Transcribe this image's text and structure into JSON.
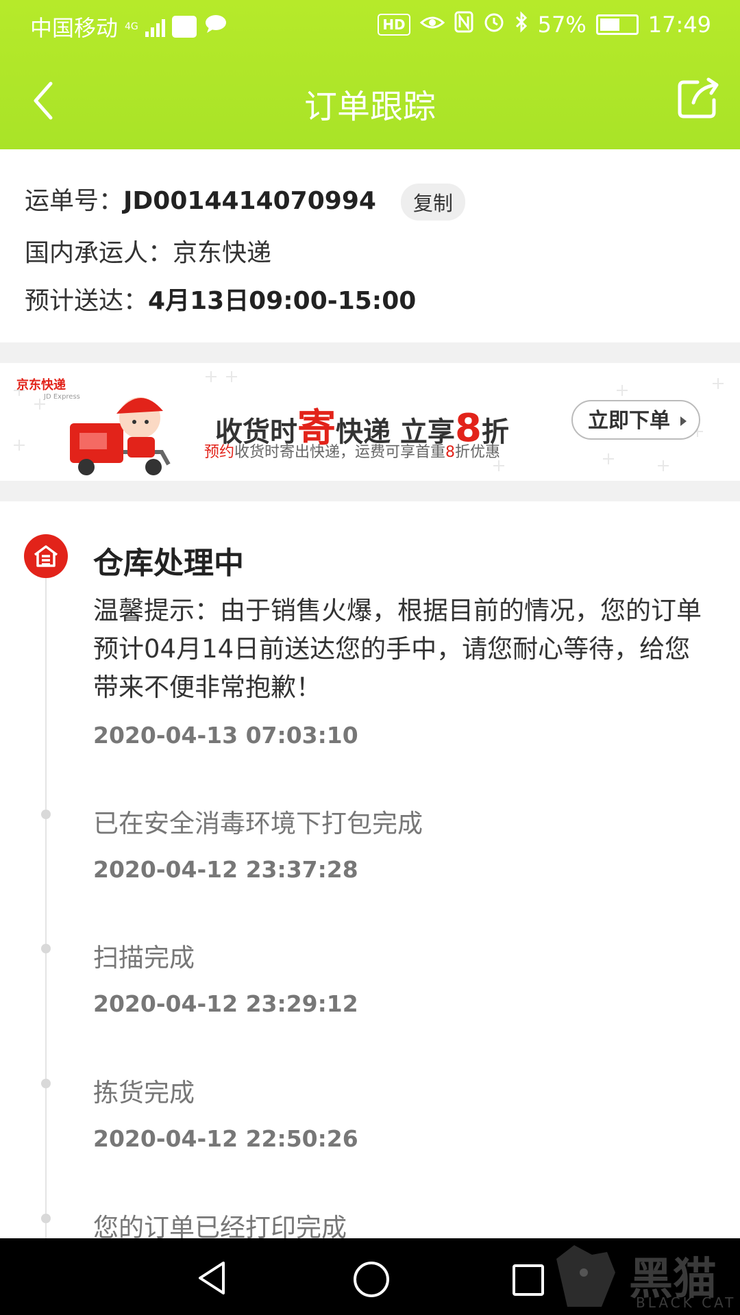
{
  "status_bar": {
    "carrier": "中国移动",
    "network": "4G",
    "battery_percent": "57%",
    "time": "17:49",
    "hd_label": "HD"
  },
  "header": {
    "title": "订单跟踪",
    "back_icon": "chevron-left-icon",
    "share_icon": "share-icon",
    "background_color": "#b0e62a"
  },
  "waybill": {
    "number_label": "运单号：",
    "number_value": "JD0014414070994",
    "copy_label": "复制",
    "carrier_label": "国内承运人：",
    "carrier_value": "京东快递",
    "eta_label": "预计送达：",
    "eta_value": "4月13日09:00-15:00"
  },
  "banner": {
    "brand": "京东快递",
    "brand_en": "JD Express",
    "headline_pre": "收货时",
    "headline_highlight": "寄",
    "headline_mid": "快递 立享",
    "headline_number": "8",
    "headline_post": "折",
    "sub_highlight": "预约",
    "sub_text_1": "收货时寄出快递，运费可享首重",
    "sub_number": "8",
    "sub_text_2": "折优惠",
    "button_label": "立即下单",
    "accent_color": "#e2231a"
  },
  "timeline": {
    "current": {
      "title": "仓库处理中",
      "icon": "warehouse-icon",
      "message": "温馨提示：由于销售火爆，根据目前的情况，您的订单预计04月14日前送达您的手中，请您耐心等待，给您带来不便非常抱歉！",
      "time": "2020-04-13 07:03:10"
    },
    "events": [
      {
        "text": "已在安全消毒环境下打包完成",
        "time": "2020-04-12 23:37:28"
      },
      {
        "text": "扫描完成",
        "time": "2020-04-12 23:29:12"
      },
      {
        "text": "拣货完成",
        "time": "2020-04-12 22:50:26"
      },
      {
        "text": "您的订单已经打印完成",
        "time": ""
      }
    ]
  },
  "nav_bar": {
    "back": "nav-back-icon",
    "home": "nav-home-icon",
    "recents": "nav-recents-icon"
  },
  "watermark": {
    "text": "黑猫",
    "sub": "BLACK CAT"
  }
}
